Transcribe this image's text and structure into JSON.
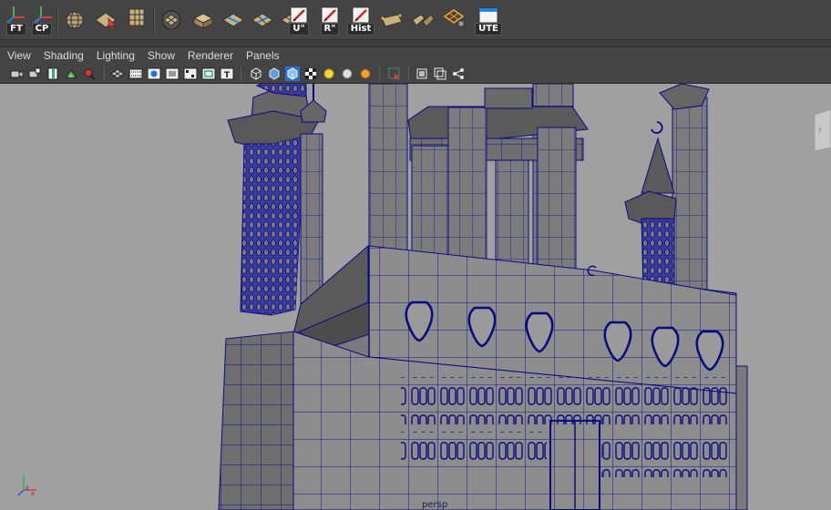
{
  "shelf": {
    "buttons": [
      {
        "label": "FT",
        "icon": "axis-gizmo-icon"
      },
      {
        "label": "CP",
        "icon": "axis-gizmo-icon"
      },
      {
        "label": "",
        "icon": "globe-grid-icon"
      },
      {
        "label": "",
        "icon": "plane-cursor-icon"
      },
      {
        "label": "",
        "icon": "uv-grid-icon"
      },
      {
        "label": "",
        "icon": "sphere-uv-icon"
      },
      {
        "label": "",
        "icon": "box-uv-icon"
      },
      {
        "label": "",
        "icon": "plane-stripe-icon"
      },
      {
        "label": "",
        "icon": "plane-stripe-icon"
      },
      {
        "label": "",
        "icon": "plane-grid-icon"
      },
      {
        "label": "U\"",
        "icon": "pen-doc-icon"
      },
      {
        "label": "R\"",
        "icon": "pen-doc-icon"
      },
      {
        "label": "Hist",
        "icon": "pen-doc-icon"
      },
      {
        "label": "",
        "icon": "uv-layout-icon"
      },
      {
        "label": "",
        "icon": "uv-split-icon"
      },
      {
        "label": "",
        "icon": "uv-lattice-icon"
      },
      {
        "label": "UTE",
        "icon": "window-icon"
      }
    ]
  },
  "menubar": {
    "items": [
      "View",
      "Shading",
      "Lighting",
      "Show",
      "Renderer",
      "Panels"
    ]
  },
  "viewport": {
    "camera_label": "persp",
    "background_color": "#a0a0a0",
    "wire_color": "#0a0a80"
  }
}
